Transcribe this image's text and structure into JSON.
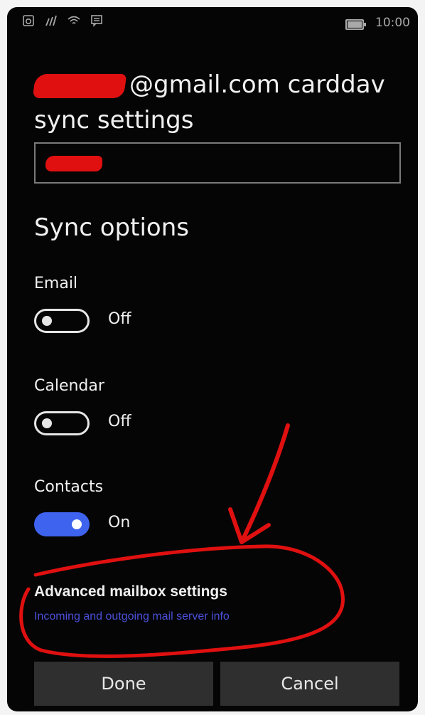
{
  "status_bar": {
    "time": "10:00",
    "icons": [
      "notification-icon",
      "signal-icon",
      "wifi-icon",
      "message-icon"
    ]
  },
  "header": {
    "title_email_suffix": "@gmail.com carddav",
    "title_line2": "sync settings"
  },
  "sync_options": {
    "heading": "Sync options",
    "items": [
      {
        "label": "Email",
        "state": "Off"
      },
      {
        "label": "Calendar",
        "state": "Off"
      },
      {
        "label": "Contacts",
        "state": "On"
      }
    ]
  },
  "advanced": {
    "title": "Advanced mailbox settings",
    "subtitle": "Incoming and outgoing mail server info"
  },
  "buttons": {
    "done": "Done",
    "cancel": "Cancel"
  },
  "colors": {
    "accent": "#3e63ef",
    "annotation": "#e01010",
    "link": "#4a50d8"
  }
}
